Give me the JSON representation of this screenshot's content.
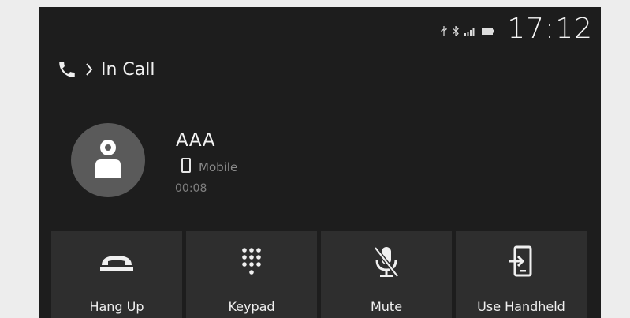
{
  "status_bar": {
    "time": "17:12",
    "icons": [
      "usb-icon",
      "bluetooth-icon",
      "signal-icon",
      "battery-icon"
    ]
  },
  "header": {
    "section_icon": "phone-icon",
    "separator_icon": "chevron-right-icon",
    "title": "In Call"
  },
  "caller": {
    "name": "AAA",
    "type_label": "Mobile",
    "type_icon": "mobile-phone-icon",
    "duration": "00:08"
  },
  "actions": [
    {
      "label": "Hang Up",
      "icon": "hang-up-icon"
    },
    {
      "label": "Keypad",
      "icon": "keypad-icon"
    },
    {
      "label": "Mute",
      "icon": "mic-muted-icon"
    },
    {
      "label": "Use Handheld",
      "icon": "handheld-icon"
    }
  ],
  "colors": {
    "screen_background": "#1d1d1d",
    "button_background": "#2e2e2e",
    "avatar_background": "#5a5a5a",
    "text_primary": "#f0f0f0",
    "text_secondary": "#8b8b8b"
  }
}
